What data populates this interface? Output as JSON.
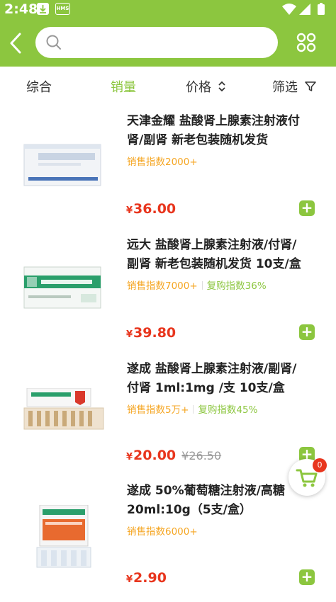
{
  "status_bar": {
    "time": "2:48",
    "hms_label": "HMS"
  },
  "search": {
    "placeholder": ""
  },
  "sort_tabs": [
    {
      "label": "综合"
    },
    {
      "label": "销量",
      "active": true
    },
    {
      "label": "价格"
    },
    {
      "label": "筛选"
    }
  ],
  "products": [
    {
      "title_line1": "天津金耀 盐酸肾上腺素注射液付",
      "title_line2": "肾/副肾 新老包装随机发货",
      "sales": "销售指数2000+",
      "repurchase": "",
      "currency": "¥",
      "price": "36.00",
      "orig_price": ""
    },
    {
      "title_line1": "远大 盐酸肾上腺素注射液/付肾/",
      "title_line2": "副肾 新老包装随机发货 10支/盒",
      "sales": "销售指数7000+",
      "repurchase": "复购指数36%",
      "currency": "¥",
      "price": "39.80",
      "orig_price": ""
    },
    {
      "title_line1": "遂成 盐酸肾上腺素注射液/副肾/",
      "title_line2": "付肾 1ml:1mg /支 10支/盒",
      "sales": "销售指数5万+",
      "repurchase": "复购指数45%",
      "currency": "¥",
      "price": "20.00",
      "orig_price": "¥26.50"
    },
    {
      "title_line1": "遂成 50%葡萄糖注射液/高糖",
      "title_line2": "20ml:10g（5支/盒）",
      "sales": "销售指数6000+",
      "repurchase": "",
      "currency": "¥",
      "price": "2.90",
      "orig_price": ""
    }
  ],
  "cart": {
    "count": "0"
  },
  "colors": {
    "brand": "#8cc63f",
    "price": "#e8361e",
    "sales": "#f5a623"
  }
}
